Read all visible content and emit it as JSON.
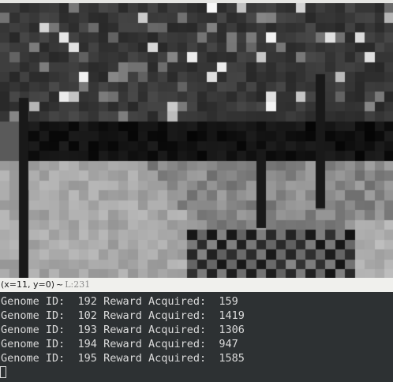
{
  "viewer": {
    "status": {
      "coords": "(x=11, y=0)",
      "separator": "~",
      "level": "L:231"
    }
  },
  "terminal": {
    "rows": [
      {
        "label": "Genome ID:",
        "id": "192",
        "reward_label": "Reward Acquired:",
        "reward": "159"
      },
      {
        "label": "Genome ID:",
        "id": "102",
        "reward_label": "Reward Acquired:",
        "reward": "1419"
      },
      {
        "label": "Genome ID:",
        "id": "193",
        "reward_label": "Reward Acquired:",
        "reward": "1306"
      },
      {
        "label": "Genome ID:",
        "id": "194",
        "reward_label": "Reward Acquired:",
        "reward": "947"
      },
      {
        "label": "Genome ID:",
        "id": "195",
        "reward_label": "Reward Acquired:",
        "reward": "1585"
      }
    ]
  }
}
